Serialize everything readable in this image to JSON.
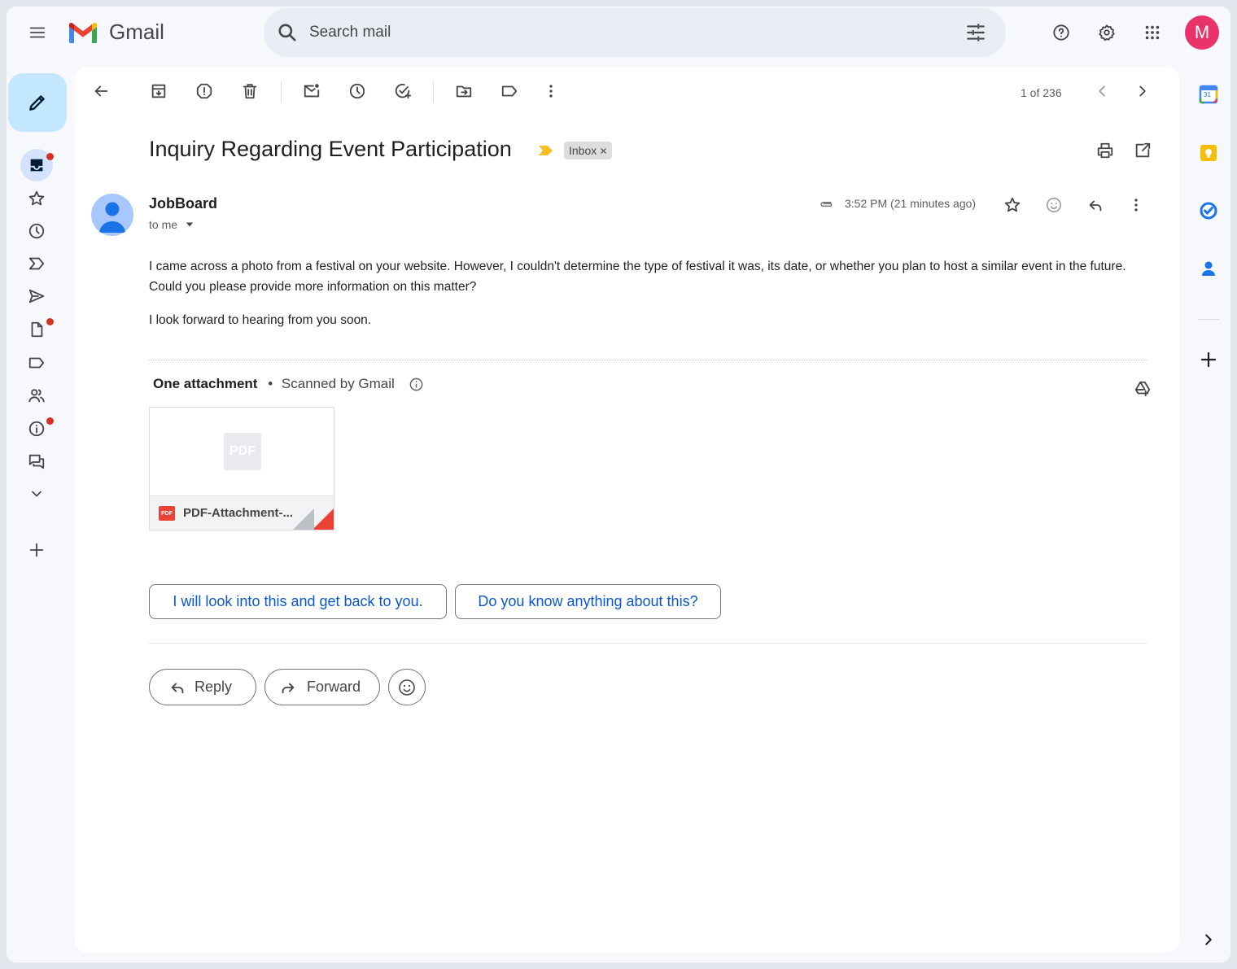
{
  "app": {
    "name": "Gmail"
  },
  "search": {
    "placeholder": "Search mail"
  },
  "account": {
    "initial": "M"
  },
  "toolbar": {
    "pager": "1 of 236"
  },
  "email": {
    "subject": "Inquiry Regarding Event Participation",
    "label_chip": "Inbox",
    "sender": "JobBoard",
    "recipient": "to me",
    "time": "3:52 PM (21 minutes ago)",
    "paragraphs": [
      "I came across a photo from a festival on your website. However, I couldn't determine the type of festival it was, its date, or whether you plan to host a similar event in the future. Could you please provide more information on this matter?",
      "I look forward to hearing from you soon."
    ]
  },
  "attachments": {
    "title": "One attachment",
    "scanned": "Scanned by Gmail",
    "file_name": "PDF-Attachment-...",
    "thumb_label": "PDF",
    "badge_label": "PDF"
  },
  "smart_replies": [
    "I will look into this and get back to you.",
    "Do you know anything about this?"
  ],
  "actions": {
    "reply": "Reply",
    "forward": "Forward"
  },
  "side_apps": {
    "calendar_day": "31"
  },
  "colors": {
    "accent": "#0b57d0",
    "compose_bg": "#c2e7ff",
    "avatar": "#e8336b",
    "unread_dot": "#d93025"
  }
}
